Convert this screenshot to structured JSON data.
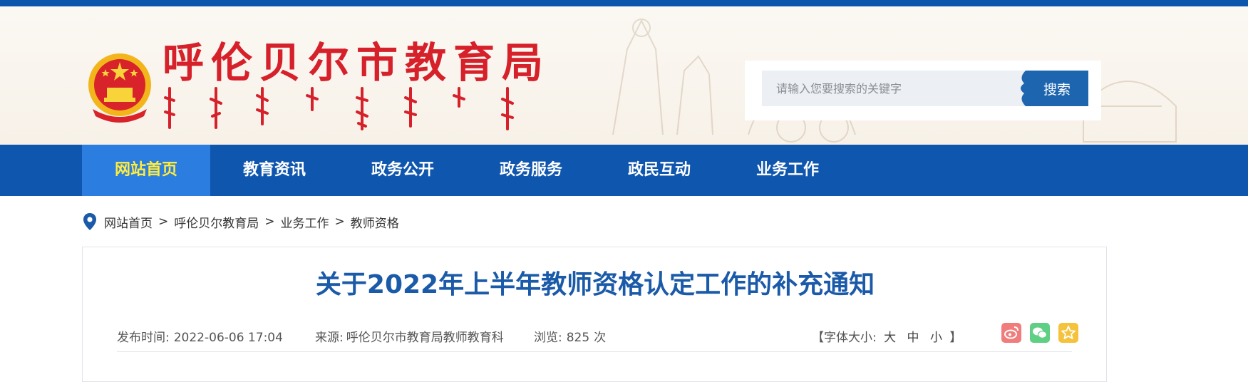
{
  "header": {
    "site_title": "呼伦贝尔市教育局",
    "search": {
      "placeholder": "请输入您要搜索的关键字",
      "button_label": "搜索"
    }
  },
  "nav": {
    "items": [
      {
        "label": "网站首页"
      },
      {
        "label": "教育资讯"
      },
      {
        "label": "政务公开"
      },
      {
        "label": "政务服务"
      },
      {
        "label": "政民互动"
      },
      {
        "label": "业务工作"
      }
    ],
    "active_index": 0
  },
  "breadcrumb": {
    "items": [
      "网站首页",
      "呼伦贝尔教育局",
      "业务工作",
      "教师资格"
    ],
    "separator": ">"
  },
  "article": {
    "title": "关于2022年上半年教师资格认定工作的补充通知",
    "publish_label": "发布时间:",
    "publish_time": "2022-06-06 17:04",
    "source_label": "来源:",
    "source": "呼伦贝尔市教育局教师教育科",
    "views_label": "浏览:",
    "views": "825",
    "views_unit": "次",
    "font_size_label": "【字体大小:",
    "font_size_large": "大",
    "font_size_medium": "中",
    "font_size_small": "小",
    "font_size_end": "】"
  },
  "share": {
    "icons": [
      "weibo-icon",
      "wechat-icon",
      "favorite-icon"
    ],
    "colors": {
      "weibo": "#f07c7c",
      "wechat": "#5fcf84",
      "favorite": "#f5c23c"
    }
  },
  "colors": {
    "top_bar": "#0b55ad",
    "nav_bg": "#0f56ae",
    "nav_active_bg": "#2b7de0",
    "nav_active_text": "#ffec3d",
    "title_red": "#d6202a",
    "article_title": "#1a5aa8"
  }
}
